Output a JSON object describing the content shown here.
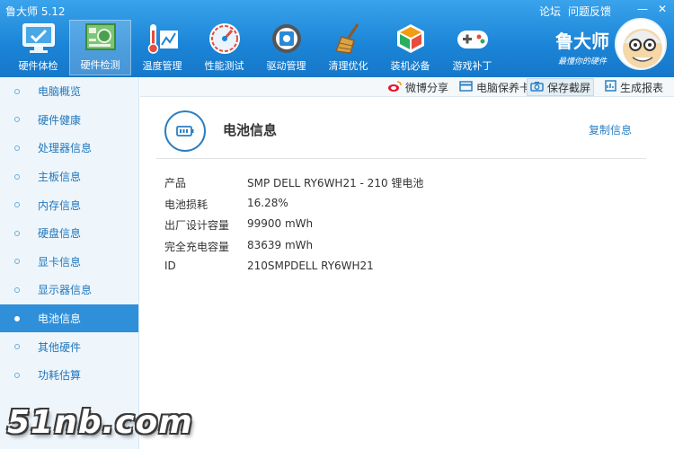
{
  "app": {
    "title": "鲁大师 5.12"
  },
  "top_links": {
    "forum": "论坛",
    "feedback": "问题反馈"
  },
  "window_buttons": {
    "minimize": "—",
    "close": "✕"
  },
  "nav": {
    "items": [
      {
        "label": "硬件体检",
        "icon": "monitor-check-icon"
      },
      {
        "label": "硬件检测",
        "icon": "circuit-board-icon"
      },
      {
        "label": "温度管理",
        "icon": "thermometer-chart-icon"
      },
      {
        "label": "性能测试",
        "icon": "speedometer-icon"
      },
      {
        "label": "驱动管理",
        "icon": "gear-chip-icon"
      },
      {
        "label": "清理优化",
        "icon": "broom-icon"
      },
      {
        "label": "装机必备",
        "icon": "cube-icon"
      },
      {
        "label": "游戏补丁",
        "icon": "gamepad-icon"
      }
    ],
    "active_index": 1
  },
  "brand": {
    "name": "鲁大师",
    "slogan": "最懂你的硬件"
  },
  "sidebar": {
    "items": [
      {
        "label": "电脑概览"
      },
      {
        "label": "硬件健康"
      },
      {
        "label": "处理器信息"
      },
      {
        "label": "主板信息"
      },
      {
        "label": "内存信息"
      },
      {
        "label": "硬盘信息"
      },
      {
        "label": "显卡信息"
      },
      {
        "label": "显示器信息"
      },
      {
        "label": "电池信息"
      },
      {
        "label": "其他硬件"
      },
      {
        "label": "功耗估算"
      }
    ],
    "active_index": 8
  },
  "toolbar": {
    "weibo": "微博分享",
    "guarantee": "电脑保养卡",
    "screenshot": "保存截屏",
    "report": "生成报表"
  },
  "panel": {
    "title": "电池信息",
    "copy": "复制信息",
    "rows": [
      {
        "key": "产品",
        "value": "SMP DELL RY6WH21 - 210 锂电池"
      },
      {
        "key": "电池损耗",
        "value": "16.28%"
      },
      {
        "key": "出厂设计容量",
        "value": "99900 mWh"
      },
      {
        "key": "完全充电容量",
        "value": "83639 mWh"
      },
      {
        "key": "ID",
        "value": "210SMPDELL RY6WH21"
      }
    ]
  },
  "watermark": "51nb.com",
  "colors": {
    "accent": "#1b84d6",
    "sidebar_active": "#2f8fd9",
    "link": "#2a7fc4"
  }
}
